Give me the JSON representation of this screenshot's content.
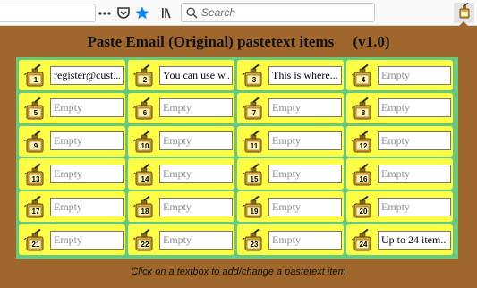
{
  "toolbar": {
    "search_placeholder": "Search",
    "icons": [
      "overflow-menu-icon",
      "pocket-icon",
      "bookmark-star-icon",
      "library-icon",
      "search-icon",
      "extension-glue-icon"
    ]
  },
  "popup": {
    "title": "Paste Email (Original) pastetext items     (v1.0)",
    "footer": "Click on a textbox to add/change a pastetext item",
    "empty_placeholder": "Empty",
    "items": [
      {
        "num": "1",
        "value": "register@cust..."
      },
      {
        "num": "2",
        "value": "You can use w..."
      },
      {
        "num": "3",
        "value": "This is where..."
      },
      {
        "num": "4",
        "value": ""
      },
      {
        "num": "5",
        "value": ""
      },
      {
        "num": "6",
        "value": ""
      },
      {
        "num": "7",
        "value": ""
      },
      {
        "num": "8",
        "value": ""
      },
      {
        "num": "9",
        "value": ""
      },
      {
        "num": "10",
        "value": ""
      },
      {
        "num": "11",
        "value": ""
      },
      {
        "num": "12",
        "value": ""
      },
      {
        "num": "13",
        "value": ""
      },
      {
        "num": "14",
        "value": ""
      },
      {
        "num": "15",
        "value": ""
      },
      {
        "num": "16",
        "value": ""
      },
      {
        "num": "17",
        "value": ""
      },
      {
        "num": "18",
        "value": ""
      },
      {
        "num": "19",
        "value": ""
      },
      {
        "num": "20",
        "value": ""
      },
      {
        "num": "21",
        "value": ""
      },
      {
        "num": "22",
        "value": ""
      },
      {
        "num": "23",
        "value": ""
      },
      {
        "num": "24",
        "value": "Up to 24 item..."
      }
    ]
  },
  "colors": {
    "panel_bg": "#a0672c",
    "grid_bg": "#67c880",
    "cell_bg": "#ffff46"
  }
}
